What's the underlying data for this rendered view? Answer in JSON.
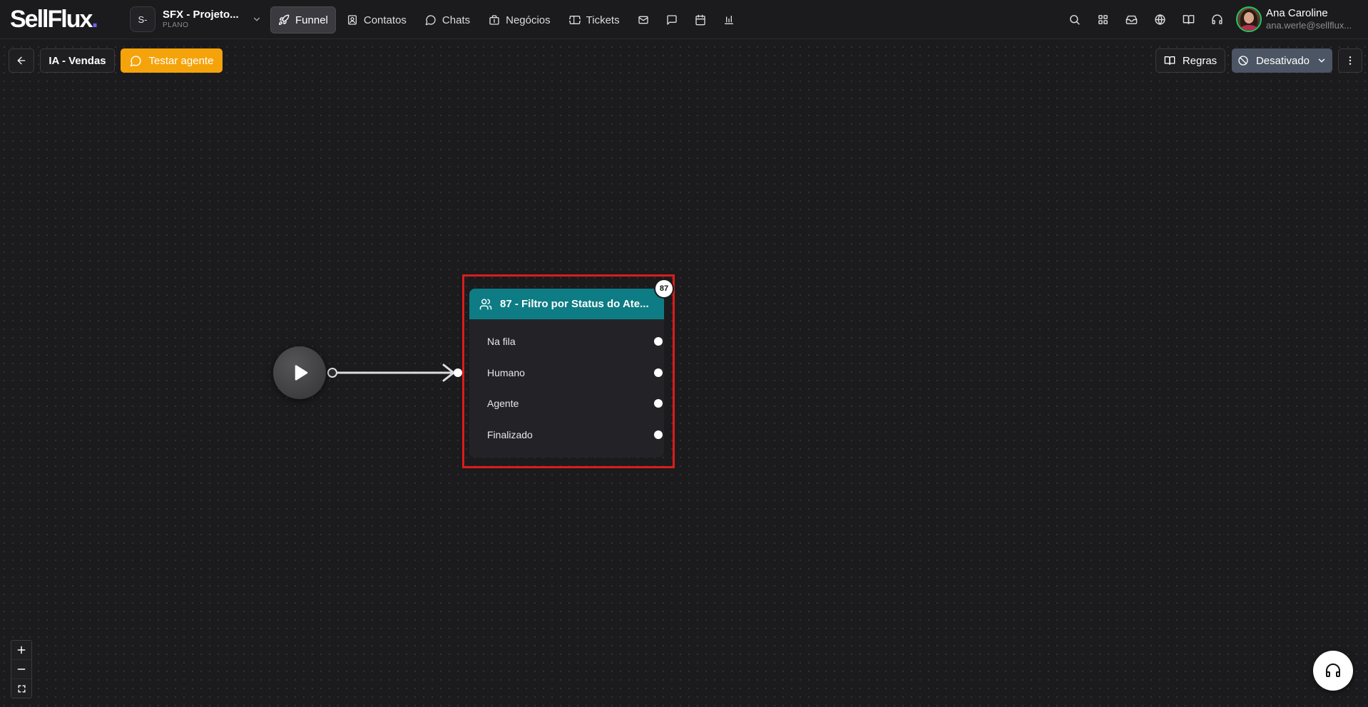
{
  "header": {
    "logo_text": "SellFlux",
    "logo_dot": ".",
    "project": {
      "avatar": "S-",
      "name": "SFX - Projeto...",
      "plan": "PLANO"
    },
    "nav": [
      {
        "label": "Funnel",
        "icon": "rocket-icon",
        "active": true
      },
      {
        "label": "Contatos",
        "icon": "contacts-icon"
      },
      {
        "label": "Chats",
        "icon": "chat-bubble-icon"
      },
      {
        "label": "Negócios",
        "icon": "briefcase-icon"
      },
      {
        "label": "Tickets",
        "icon": "ticket-icon"
      }
    ],
    "nav_icons": [
      "mail-icon",
      "message-square-icon",
      "calendar-icon",
      "bar-chart-icon"
    ],
    "right_icons": [
      "search-icon",
      "apps-grid-icon",
      "inbox-icon",
      "globe-icon",
      "book-icon",
      "headset-icon"
    ],
    "user": {
      "name": "Ana Caroline",
      "email": "ana.werle@sellflux..."
    }
  },
  "toolbar": {
    "agent_name": "IA - Vendas",
    "test_label": "Testar agente",
    "rules_label": "Regras",
    "status_label": "Desativado"
  },
  "node": {
    "badge": "87",
    "title": "87 - Filtro por Status do Ate...",
    "outputs": [
      "Na fila",
      "Humano",
      "Agente",
      "Finalizado"
    ]
  },
  "accent": {
    "node_header": "#0e7c84",
    "test_button": "#f5a30b",
    "status_button": "#4c5564",
    "selection_border": "#dc1c1c"
  }
}
